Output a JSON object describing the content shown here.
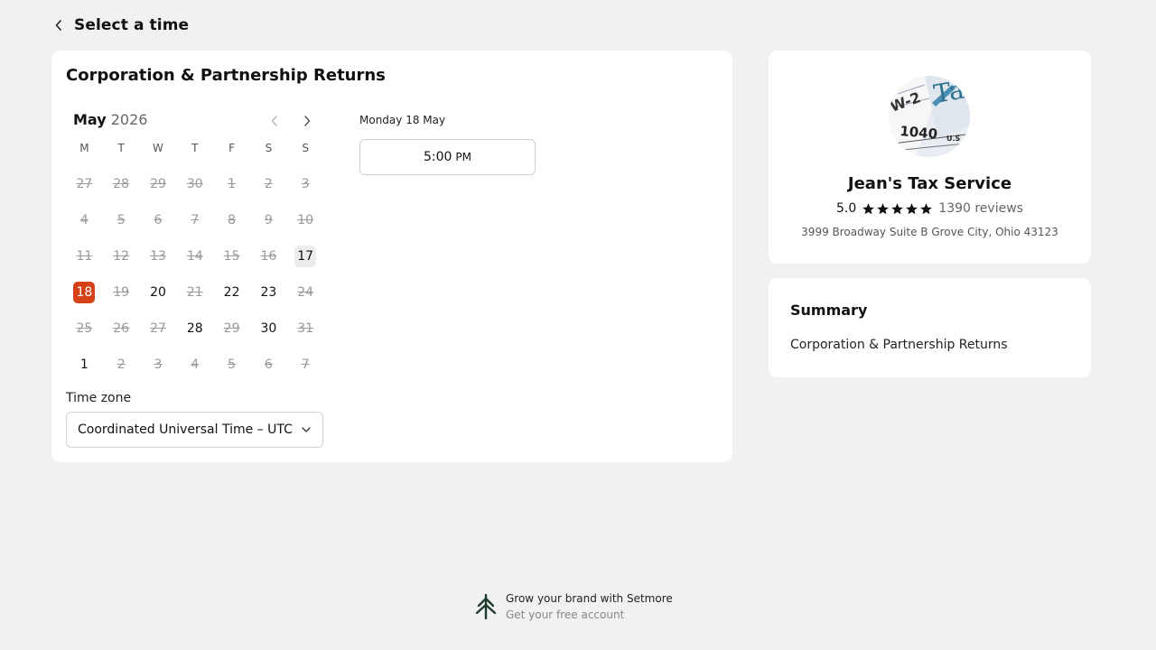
{
  "header": {
    "title": "Select a time",
    "back_icon": "chevron-left-icon"
  },
  "service": {
    "title": "Corporation & Partnership Returns"
  },
  "calendar": {
    "month": "May",
    "year": "2026",
    "weekdays": [
      "M",
      "T",
      "W",
      "T",
      "F",
      "S",
      "S"
    ],
    "weeks": [
      [
        {
          "d": "27",
          "s": "disabled"
        },
        {
          "d": "28",
          "s": "disabled"
        },
        {
          "d": "29",
          "s": "disabled"
        },
        {
          "d": "30",
          "s": "disabled"
        },
        {
          "d": "1",
          "s": "disabled"
        },
        {
          "d": "2",
          "s": "disabled"
        },
        {
          "d": "3",
          "s": "disabled"
        }
      ],
      [
        {
          "d": "4",
          "s": "disabled"
        },
        {
          "d": "5",
          "s": "disabled"
        },
        {
          "d": "6",
          "s": "disabled"
        },
        {
          "d": "7",
          "s": "disabled"
        },
        {
          "d": "8",
          "s": "disabled"
        },
        {
          "d": "9",
          "s": "disabled"
        },
        {
          "d": "10",
          "s": "disabled"
        }
      ],
      [
        {
          "d": "11",
          "s": "disabled"
        },
        {
          "d": "12",
          "s": "disabled"
        },
        {
          "d": "13",
          "s": "disabled"
        },
        {
          "d": "14",
          "s": "disabled"
        },
        {
          "d": "15",
          "s": "disabled"
        },
        {
          "d": "16",
          "s": "disabled"
        },
        {
          "d": "17",
          "s": "today"
        }
      ],
      [
        {
          "d": "18",
          "s": "selected"
        },
        {
          "d": "19",
          "s": "disabled"
        },
        {
          "d": "20",
          "s": "available"
        },
        {
          "d": "21",
          "s": "disabled"
        },
        {
          "d": "22",
          "s": "available"
        },
        {
          "d": "23",
          "s": "available"
        },
        {
          "d": "24",
          "s": "disabled"
        }
      ],
      [
        {
          "d": "25",
          "s": "disabled"
        },
        {
          "d": "26",
          "s": "disabled"
        },
        {
          "d": "27",
          "s": "disabled"
        },
        {
          "d": "28",
          "s": "available"
        },
        {
          "d": "29",
          "s": "disabled"
        },
        {
          "d": "30",
          "s": "available"
        },
        {
          "d": "31",
          "s": "disabled"
        }
      ],
      [
        {
          "d": "1",
          "s": "available"
        },
        {
          "d": "2",
          "s": "disabled"
        },
        {
          "d": "3",
          "s": "disabled"
        },
        {
          "d": "4",
          "s": "disabled"
        },
        {
          "d": "5",
          "s": "disabled"
        },
        {
          "d": "6",
          "s": "disabled"
        },
        {
          "d": "7",
          "s": "disabled"
        }
      ]
    ],
    "selected_color": "#d64218"
  },
  "timezone": {
    "label": "Time zone",
    "value": "Coordinated Universal Time – UTC"
  },
  "slots": {
    "date_heading": "Monday 18 May",
    "items": [
      {
        "time": "5:00",
        "ampm": "PM"
      }
    ]
  },
  "business": {
    "name": "Jean's Tax Service",
    "rating": "5.0",
    "stars": 5,
    "reviews": "1390 reviews",
    "address": "3999 Broadway Suite B Grove City, Ohio 43123"
  },
  "summary": {
    "title": "Summary",
    "item": "Corporation & Partnership Returns"
  },
  "footer": {
    "line1": "Grow your brand with Setmore",
    "line2": "Get your free account",
    "logo_icon": "setmore-tree-icon"
  }
}
